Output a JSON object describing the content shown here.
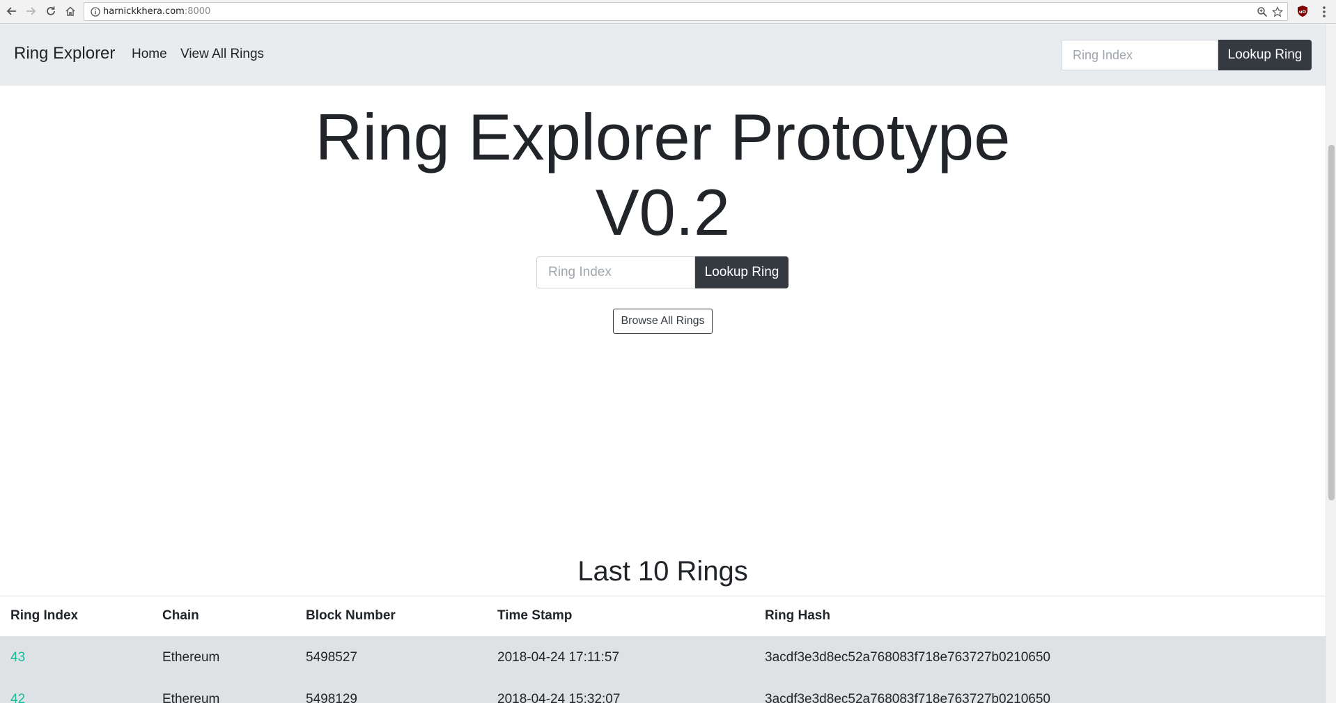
{
  "browser": {
    "url_host": "harnickkhera.com",
    "url_port": ":8000"
  },
  "navbar": {
    "brand": "Ring Explorer",
    "links": [
      "Home",
      "View All Rings"
    ],
    "search_placeholder": "Ring Index",
    "search_button": "Lookup Ring"
  },
  "hero": {
    "title_line1": "Ring Explorer Prototype",
    "title_line2": "V0.2",
    "search_placeholder": "Ring Index",
    "search_button": "Lookup Ring",
    "browse_button": "Browse All Rings"
  },
  "rings_section": {
    "title": "Last 10 Rings",
    "columns": [
      "Ring Index",
      "Chain",
      "Block Number",
      "Time Stamp",
      "Ring Hash"
    ],
    "rows": [
      {
        "ring_index": "43",
        "chain": "Ethereum",
        "block_number": "5498527",
        "time_stamp": "2018-04-24 17:11:57",
        "ring_hash": "3acdf3e3d8ec52a768083f718e763727b0210650"
      },
      {
        "ring_index": "42",
        "chain": "Ethereum",
        "block_number": "5498129",
        "time_stamp": "2018-04-24 15:32:07",
        "ring_hash": "3acdf3e3d8ec52a768083f718e763727b0210650"
      }
    ]
  },
  "colors": {
    "navbar_bg": "#e9ecef",
    "button_dark": "#343a40",
    "link_accent": "#18bc9c",
    "row_bg": "#dfe2e5"
  }
}
